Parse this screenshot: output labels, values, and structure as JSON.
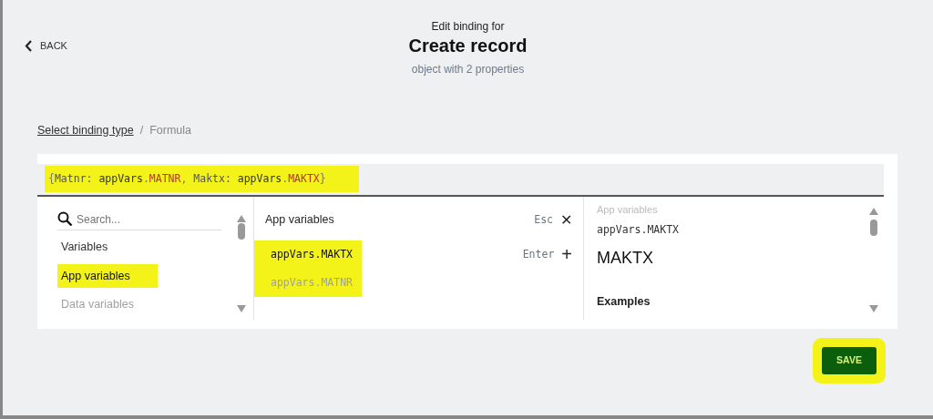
{
  "header": {
    "back": "BACK",
    "subtitle": "Edit binding for",
    "title": "Create record",
    "description": "object with 2 properties"
  },
  "breadcrumb": {
    "link": "Select binding type",
    "separator": "/",
    "current": "Formula"
  },
  "formula": {
    "highlighted": true,
    "tokens": [
      {
        "kind": "punct",
        "text": "{"
      },
      {
        "kind": "key",
        "text": "Matnr: "
      },
      {
        "kind": "ident",
        "text": "appVars"
      },
      {
        "kind": "punct",
        "text": "."
      },
      {
        "kind": "prop",
        "text": "MATNR"
      },
      {
        "kind": "punct",
        "text": ", "
      },
      {
        "kind": "key",
        "text": "Maktx: "
      },
      {
        "kind": "ident",
        "text": "appVars"
      },
      {
        "kind": "punct",
        "text": "."
      },
      {
        "kind": "prop",
        "text": "MAKTX"
      },
      {
        "kind": "punct",
        "text": "}"
      }
    ]
  },
  "categories": {
    "search": {
      "placeholder": "Search..."
    },
    "items": [
      {
        "kind": "heading",
        "label": "Variables"
      },
      {
        "kind": "item",
        "label": "App variables",
        "selected": true,
        "highlighted": true
      },
      {
        "kind": "item",
        "label": "Data variables",
        "selected": false,
        "highlighted": false
      }
    ]
  },
  "variables": {
    "title": "App variables",
    "close_key": "Esc",
    "close_icon": "✕",
    "add_key": "Enter",
    "add_icon": "+",
    "items": [
      {
        "label": "appVars.MAKTX",
        "selected": true,
        "highlighted": true
      },
      {
        "label": "appVars.MATNR",
        "selected": false,
        "highlighted": true
      }
    ]
  },
  "details": {
    "category": "App variables",
    "path": "appVars.MAKTX",
    "name": "MAKTX",
    "section": "Examples"
  },
  "save": {
    "label": "SAVE",
    "highlighted": true
  }
}
